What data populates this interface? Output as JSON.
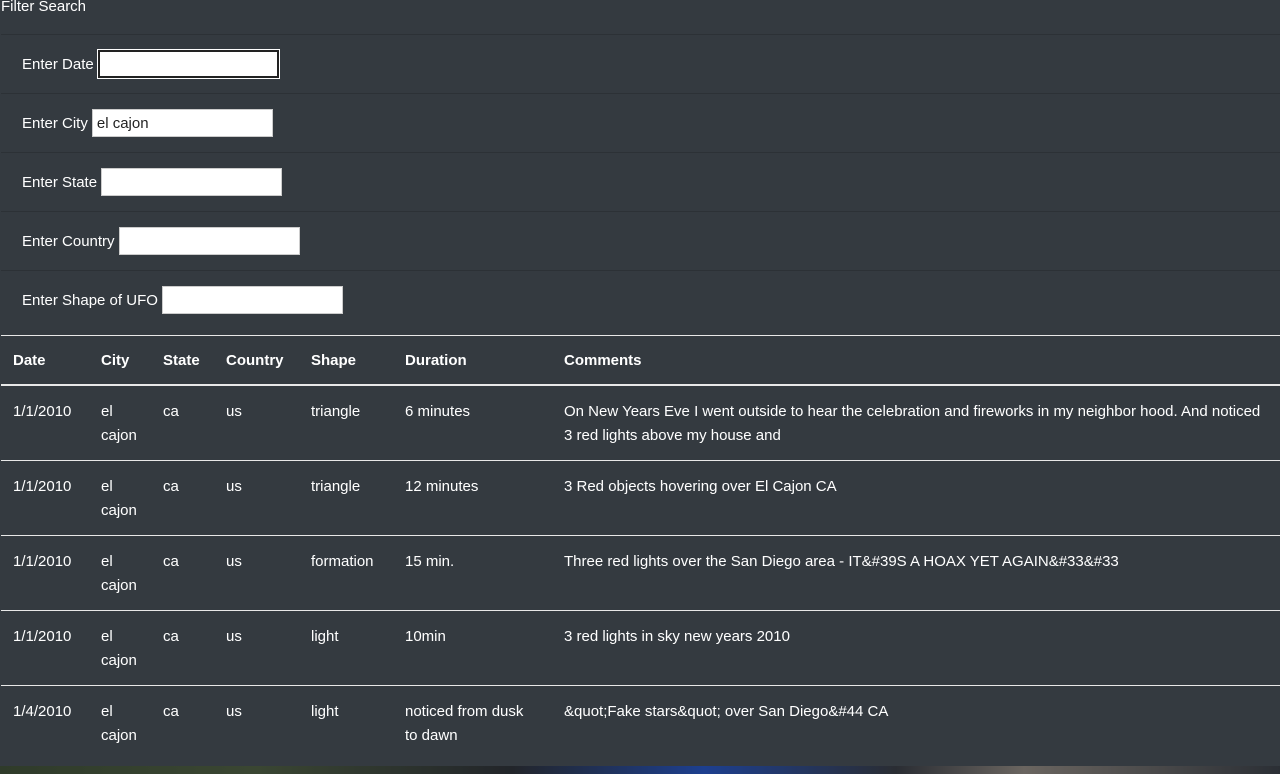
{
  "filter": {
    "title": "Filter Search",
    "fields": [
      {
        "label": "Enter Date",
        "value": "",
        "focused": true
      },
      {
        "label": "Enter City",
        "value": "el cajon",
        "focused": false
      },
      {
        "label": "Enter State",
        "value": "",
        "focused": false
      },
      {
        "label": "Enter Country",
        "value": "",
        "focused": false
      },
      {
        "label": "Enter Shape of UFO",
        "value": "",
        "focused": false
      }
    ]
  },
  "table": {
    "columns": [
      "Date",
      "City",
      "State",
      "Country",
      "Shape",
      "Duration",
      "Comments"
    ],
    "rows": [
      [
        "1/1/2010",
        "el cajon",
        "ca",
        "us",
        "triangle",
        "6 minutes",
        "On New Years Eve I went outside to hear the celebration and fireworks in my neighbor hood. And noticed 3 red lights above my house and"
      ],
      [
        "1/1/2010",
        "el cajon",
        "ca",
        "us",
        "triangle",
        "12 minutes",
        "3 Red objects hovering over El Cajon CA"
      ],
      [
        "1/1/2010",
        "el cajon",
        "ca",
        "us",
        "formation",
        "15 min.",
        "Three red lights over the San Diego area - IT&#39S A HOAX YET AGAIN&#33&#33"
      ],
      [
        "1/1/2010",
        "el cajon",
        "ca",
        "us",
        "light",
        "10min",
        "3 red lights in sky new years 2010"
      ],
      [
        "1/4/2010",
        "el cajon",
        "ca",
        "us",
        "light",
        "noticed from dusk to dawn",
        "&quot;Fake stars&quot; over San Diego&#44 CA"
      ]
    ]
  }
}
